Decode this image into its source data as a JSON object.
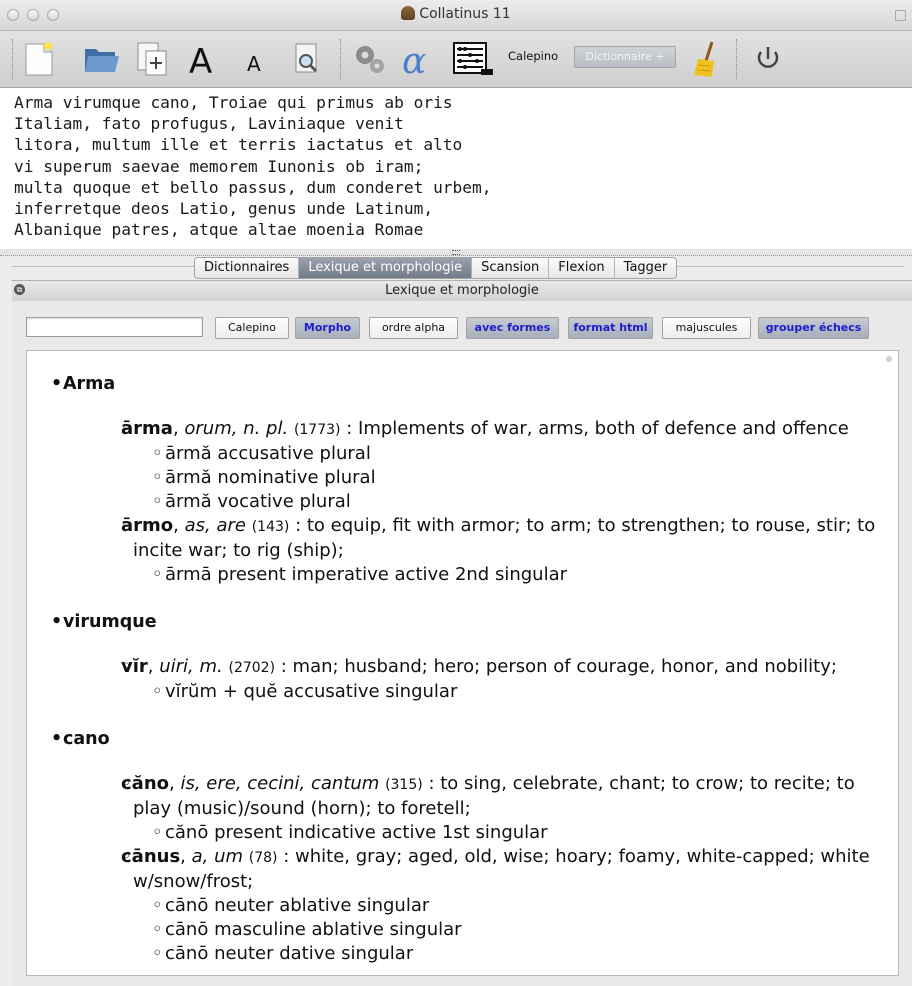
{
  "window": {
    "title": "Collatinus 11"
  },
  "toolbar": {
    "calepino_label": "Calepino",
    "dictionnaire_label": "Dictionnaire +"
  },
  "editor": {
    "text": "Arma virumque cano, Troiae qui primus ab oris\nItaliam, fato profugus, Laviniaque venit\nlitora, multum ille et terris iactatus et alto\nvi superum saevae memorem Iunonis ob iram;\nmulta quoque et bello passus, dum conderet urbem,\ninferretque deos Latio, genus unde Latinum,\nAlbanique patres, atque altae moenia Romae"
  },
  "tabs": [
    {
      "label": "Dictionnaires",
      "active": false
    },
    {
      "label": "Lexique et morphologie",
      "active": true
    },
    {
      "label": "Scansion",
      "active": false
    },
    {
      "label": "Flexion",
      "active": false
    },
    {
      "label": "Tagger",
      "active": false
    }
  ],
  "panel": {
    "title": "Lexique et morphologie",
    "search": {
      "value": "",
      "placeholder": ""
    },
    "buttons": [
      {
        "label": "Calepino",
        "on": false
      },
      {
        "label": "Morpho",
        "on": true
      },
      {
        "label": "ordre alpha",
        "on": false
      },
      {
        "label": "avec formes",
        "on": true
      },
      {
        "label": "format html",
        "on": true
      },
      {
        "label": "majuscules",
        "on": false
      },
      {
        "label": "grouper échecs",
        "on": true
      }
    ]
  },
  "results": [
    {
      "word": "Arma",
      "lemmas": [
        {
          "lemma": "ārma",
          "grammar": "orum, n. pl.",
          "freq": "(1773)",
          "definition": " : Implements of war, arms, both of defence and offence",
          "forms": [
            "ārmă accusative plural",
            "ārmă nominative plural",
            "ārmă vocative plural"
          ]
        },
        {
          "lemma": "ārmo",
          "grammar": "as, are",
          "freq": "(143)",
          "definition": " : to equip, fit with armor; to arm; to strengthen; to rouse, stir; to incite war; to rig (ship);",
          "forms": [
            "ārmā present imperative active 2nd singular"
          ]
        }
      ]
    },
    {
      "word": "virumque",
      "lemmas": [
        {
          "lemma": "vĭr",
          "grammar": "uiri, m.",
          "freq": "(2702)",
          "definition": " : man; husband; hero; person of courage, honor, and nobility;",
          "forms": [
            "vĭrŭm + quĕ accusative singular"
          ]
        }
      ]
    },
    {
      "word": "cano",
      "lemmas": [
        {
          "lemma": "căno",
          "grammar": "is, ere, cecini, cantum",
          "freq": "(315)",
          "definition": " : to sing, celebrate, chant; to crow; to recite; to play (music)/sound (horn); to foretell;",
          "forms": [
            "cănō present indicative active 1st singular"
          ]
        },
        {
          "lemma": "cānus",
          "grammar": "a, um",
          "freq": "(78)",
          "definition": " : white, gray; aged, old, wise; hoary; foamy, white-capped; white w/snow/frost;",
          "forms": [
            "cānō neuter ablative singular",
            "cānō masculine ablative singular",
            "cānō neuter dative singular"
          ]
        }
      ]
    }
  ]
}
